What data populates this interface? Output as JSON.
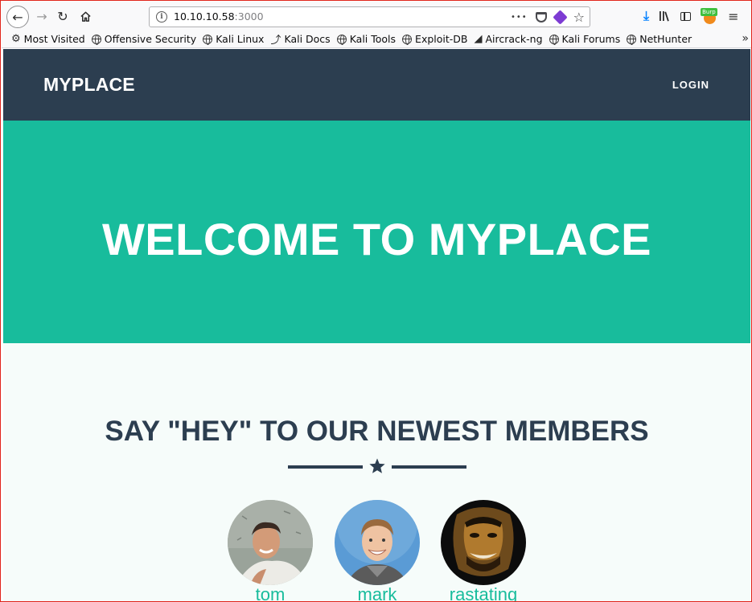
{
  "browser": {
    "url_host": "10.10.10.58",
    "url_port": ":3000",
    "url_actions_more": "•••",
    "bookmark_star": "☆",
    "burp_badge": "Burp",
    "menu_glyph": "≡",
    "overflow_glyph": "»",
    "bookmarks": [
      {
        "label": "Most Visited"
      },
      {
        "label": "Offensive Security"
      },
      {
        "label": "Kali Linux"
      },
      {
        "label": "Kali Docs"
      },
      {
        "label": "Kali Tools"
      },
      {
        "label": "Exploit-DB"
      },
      {
        "label": "Aircrack-ng"
      },
      {
        "label": "Kali Forums"
      },
      {
        "label": "NetHunter"
      }
    ]
  },
  "page": {
    "brand": "MYPLACE",
    "login_label": "LOGIN",
    "hero_title": "WELCOME TO MYPLACE",
    "members_title": "SAY \"HEY\" TO OUR NEWEST MEMBERS",
    "members": [
      {
        "name": "tom"
      },
      {
        "name": "mark"
      },
      {
        "name": "rastating"
      }
    ]
  },
  "colors": {
    "navbar": "#2c3e50",
    "hero": "#18bc9c",
    "members_bg": "#f6fcfa",
    "accent_text": "#18bc9c"
  }
}
